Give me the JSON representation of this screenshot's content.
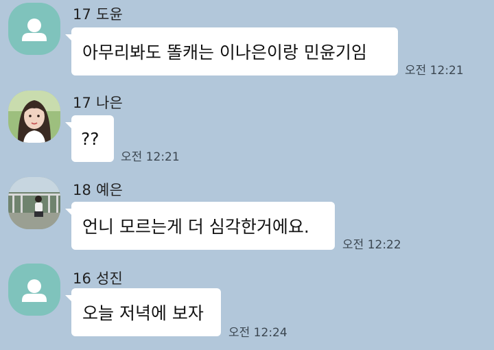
{
  "messages": [
    {
      "sender": "17 도윤",
      "text": "아무리봐도 똘캐는 이나은이랑 민윤기임",
      "time": "오전 12:21",
      "avatar": "default-profile-icon"
    },
    {
      "sender": "17 나은",
      "text": "??",
      "time": "오전 12:21",
      "avatar": "profile-photo"
    },
    {
      "sender": "18 예은",
      "text": "언니 모르는게 더 심각한거에요.",
      "time": "오전 12:22",
      "avatar": "profile-photo"
    },
    {
      "sender": "16 성진",
      "text": "오늘 저녁에 보자",
      "time": "오전 12:24",
      "avatar": "default-profile-icon"
    }
  ],
  "colors": {
    "background": "#b2c7da",
    "bubble": "#ffffff",
    "default_avatar": "#7fc3bc"
  }
}
